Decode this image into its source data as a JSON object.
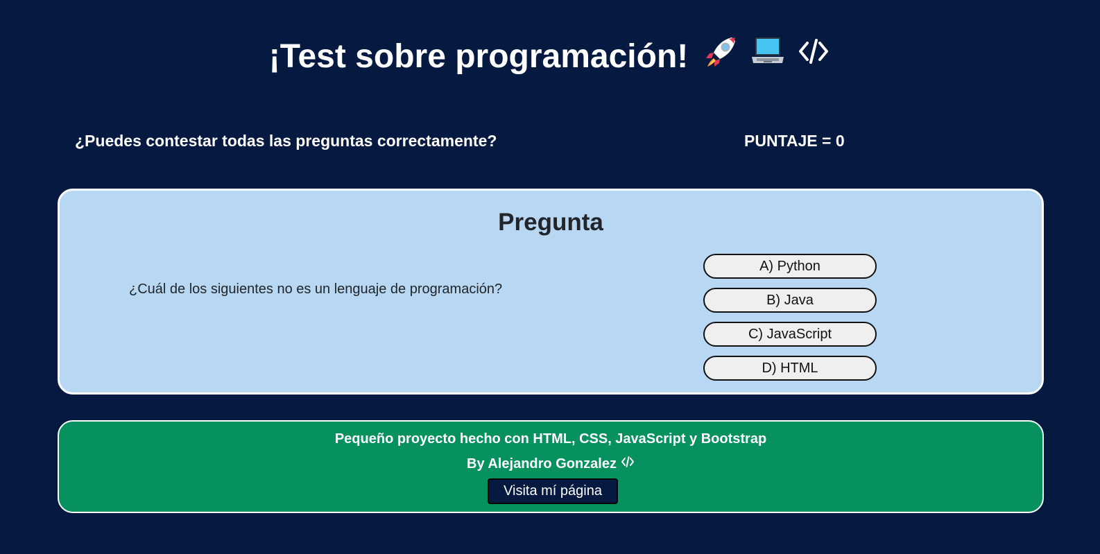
{
  "header": {
    "title": "¡Test sobre programación!",
    "icons": [
      "rocket-icon",
      "laptop-icon",
      "code-icon"
    ]
  },
  "intro": {
    "subtitle": "¿Puedes contestar todas las preguntas correctamente?",
    "score": "PUNTAJE = 0"
  },
  "question": {
    "heading": "Pregunta",
    "text": "¿Cuál de los siguientes no es un lenguaje de programación?",
    "answers": [
      "A) Python",
      "B) Java",
      "C) JavaScript",
      "D) HTML"
    ]
  },
  "footer": {
    "line1": "Pequeño proyecto hecho con HTML, CSS, JavaScript y Bootstrap",
    "line2": "By Alejandro Gonzalez",
    "button": "Visita mí página",
    "icon": "code-icon"
  },
  "colors": {
    "background": "#061941",
    "question_card": "#b8d7f3",
    "footer_card": "#07915f",
    "button_dark": "#061941",
    "answer_button": "#efefef"
  }
}
